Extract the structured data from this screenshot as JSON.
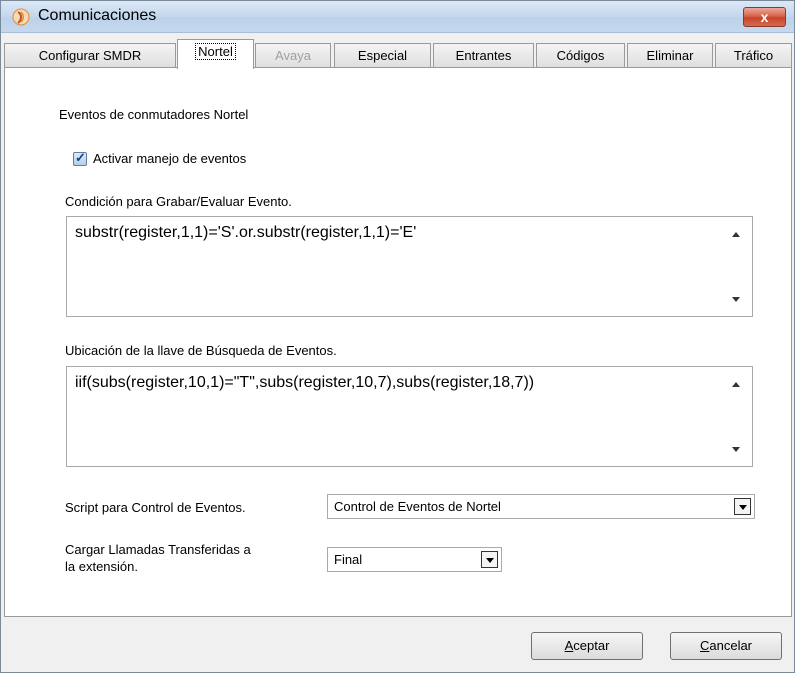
{
  "window": {
    "title": "Comunicaciones",
    "close_label": "x"
  },
  "tabs": [
    {
      "label": "Configurar SMDR"
    },
    {
      "label": "Nortel"
    },
    {
      "label": "Avaya"
    },
    {
      "label": "Especial"
    },
    {
      "label": "Entrantes"
    },
    {
      "label": "Códigos"
    },
    {
      "label": "Eliminar"
    },
    {
      "label": "Tráfico"
    }
  ],
  "panel": {
    "heading": "Eventos de conmutadores Nortel",
    "activate_checkbox_label": "Activar manejo de eventos",
    "activate_checked": true,
    "condition_label": "Condición para Grabar/Evaluar Evento.",
    "condition_value": "substr(register,1,1)='S'.or.substr(register,1,1)='E'",
    "key_label": "Ubicación de la llave de Búsqueda de Eventos.",
    "key_value": "iif(subs(register,10,1)=\"T\",subs(register,10,7),subs(register,18,7))",
    "script_label": "Script para Control de Eventos.",
    "script_value": "Control de Eventos de Nortel",
    "transfer_label_line1": "Cargar Llamadas Transferidas a",
    "transfer_label_line2": "la extensión.",
    "transfer_value": "Final"
  },
  "buttons": {
    "accept_first": "A",
    "accept_rest": "ceptar",
    "cancel_first": "C",
    "cancel_rest": "ancelar"
  }
}
